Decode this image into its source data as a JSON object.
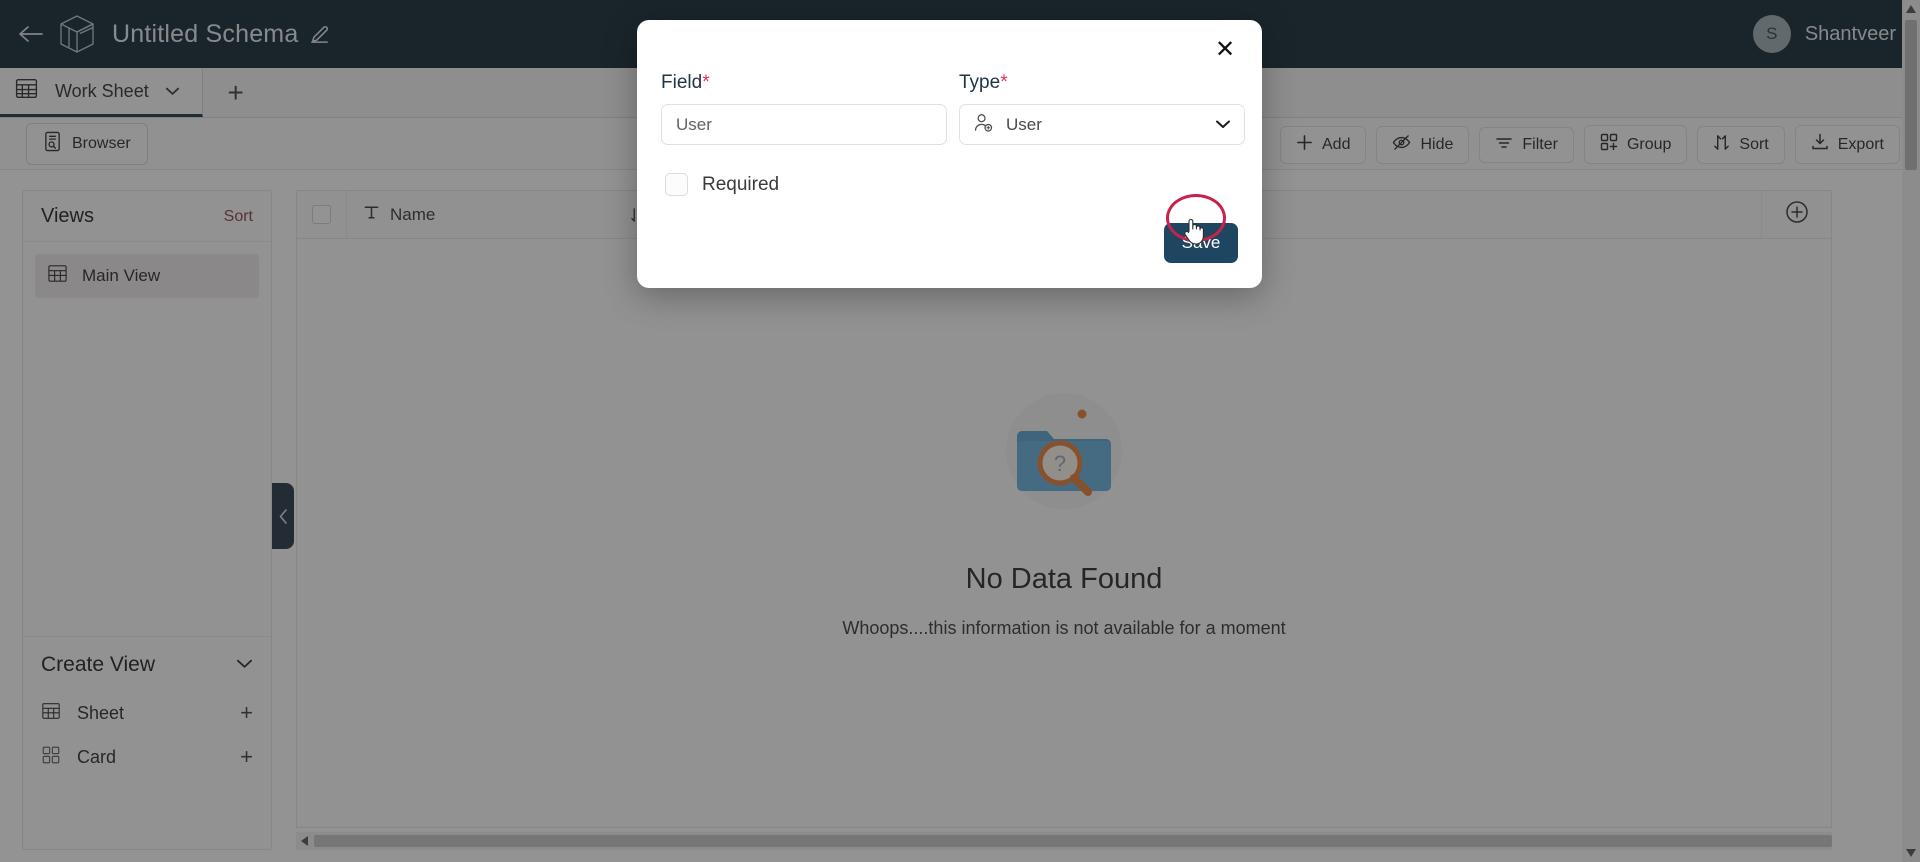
{
  "topbar": {
    "back_icon": "arrow-left-icon",
    "logo_icon": "cube-logo-icon",
    "schema_title": "Untitled Schema",
    "edit_icon": "pencil-icon",
    "avatar_initial": "S",
    "user_name": "Shantveer",
    "bg_color": "#041A27"
  },
  "tabs": {
    "items": [
      {
        "icon": "grid-icon",
        "label": "Work Sheet",
        "caret": "chevron-down-icon",
        "active": true
      }
    ],
    "add_tab_label": "+"
  },
  "toolbar": {
    "browser_label": "Browser",
    "browser_icon": "document-search-icon",
    "actions": [
      {
        "label": "Add",
        "icon": "plus-icon"
      },
      {
        "label": "Hide",
        "icon": "eye-off-icon"
      },
      {
        "label": "Filter",
        "icon": "filter-icon"
      },
      {
        "label": "Group",
        "icon": "group-icon"
      },
      {
        "label": "Sort",
        "icon": "sort-icon"
      },
      {
        "label": "Export",
        "icon": "download-icon"
      }
    ]
  },
  "sidebar": {
    "views_title": "Views",
    "views_sort_label": "Sort",
    "views_sort_color": "#8d2f3f",
    "views": [
      {
        "label": "Main View",
        "icon": "grid-icon",
        "selected": true
      }
    ],
    "create_view": {
      "title": "Create View",
      "caret": "chevron-down-icon",
      "options": [
        {
          "label": "Sheet",
          "icon": "grid-icon",
          "add": "+"
        },
        {
          "label": "Card",
          "icon": "cards-icon",
          "add": "+"
        }
      ]
    },
    "collapse_icon": "chevron-left-icon"
  },
  "grid": {
    "header": {
      "select_all": "",
      "columns": [
        {
          "label": "Name",
          "type_icon": "text-type-icon",
          "sort_icon": "sort-arrows-icon",
          "menu_icon": "chevron-down-icon"
        }
      ],
      "add_column_icon": "plus-circle-icon"
    },
    "empty_state": {
      "icon": "folder-search-icon",
      "title": "No Data Found",
      "subtitle": "Whoops....this information is not available for a moment"
    },
    "hscroll_left_icon": "triangle-left-icon",
    "vscroll_up_icon": "triangle-up-icon",
    "vscroll_down_icon": "triangle-down-icon"
  },
  "modal": {
    "close_icon": "close-icon",
    "field": {
      "label": "Field",
      "required_marker": "*",
      "value": "User",
      "placeholder": "User"
    },
    "type": {
      "label": "Type",
      "required_marker": "*",
      "value": "User",
      "icon": "user-settings-icon",
      "caret": "chevron-down-icon"
    },
    "required_checkbox": {
      "label": "Required",
      "checked": false
    },
    "save_label": "Save",
    "save_bg": "#1f4660",
    "annotation_color": "#c8224b",
    "cursor_icon": "hand-pointer-cursor"
  }
}
